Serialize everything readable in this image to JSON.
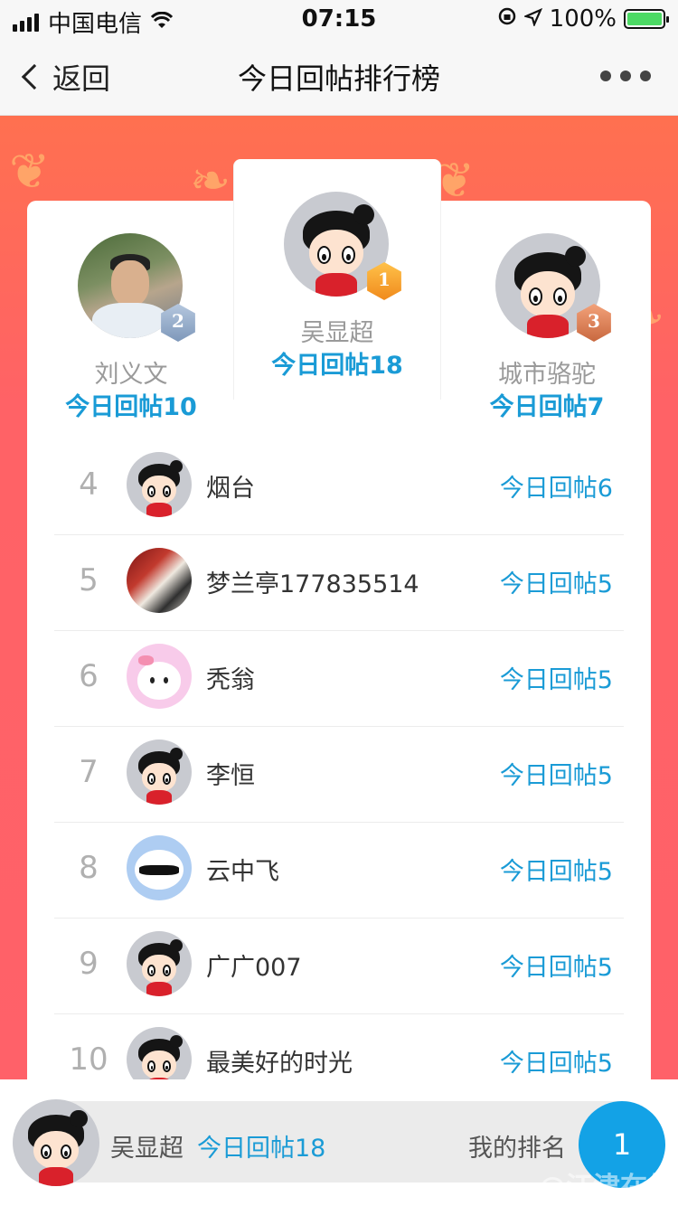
{
  "status_bar": {
    "carrier": "中国电信",
    "time": "07:15",
    "battery": "100%"
  },
  "nav": {
    "back_label": "返回",
    "title": "今日回帖排行榜"
  },
  "podium": [
    {
      "rank": "1",
      "name": "吴显超",
      "count": "今日回帖18",
      "avatar": "cartoon-avatar",
      "badge_color": "#f39a2a"
    },
    {
      "rank": "2",
      "name": "刘义文",
      "count": "今日回帖10",
      "avatar": "photo-avatar",
      "badge_color": "#8ea6c6"
    },
    {
      "rank": "3",
      "name": "城市骆驼",
      "count": "今日回帖7",
      "avatar": "cartoon-avatar",
      "badge_color": "#d9794d"
    }
  ],
  "ranking": [
    {
      "rank": "4",
      "name": "烟台",
      "count": "今日回帖6",
      "avatar": "cartoon-avatar"
    },
    {
      "rank": "5",
      "name": "梦兰亭177835514",
      "count": "今日回帖5",
      "avatar": "photo-avatar"
    },
    {
      "rank": "6",
      "name": "秃翁",
      "count": "今日回帖5",
      "avatar": "pink-cloud-avatar"
    },
    {
      "rank": "7",
      "name": "李恒",
      "count": "今日回帖5",
      "avatar": "cartoon-avatar"
    },
    {
      "rank": "8",
      "name": "云中飞",
      "count": "今日回帖5",
      "avatar": "blue-cloud-avatar"
    },
    {
      "rank": "9",
      "name": "广广007",
      "count": "今日回帖5",
      "avatar": "cartoon-avatar"
    },
    {
      "rank": "10",
      "name": "最美好的时光",
      "count": "今日回帖5",
      "avatar": "cartoon-avatar"
    }
  ],
  "my_rank": {
    "name": "吴显超",
    "count": "今日回帖18",
    "label": "我的排名",
    "rank": "1"
  },
  "watermark": "@江津在线",
  "colors": {
    "accent": "#1a9bd6",
    "banner": "#ff6169",
    "rank_badge": "#13a2e6"
  }
}
